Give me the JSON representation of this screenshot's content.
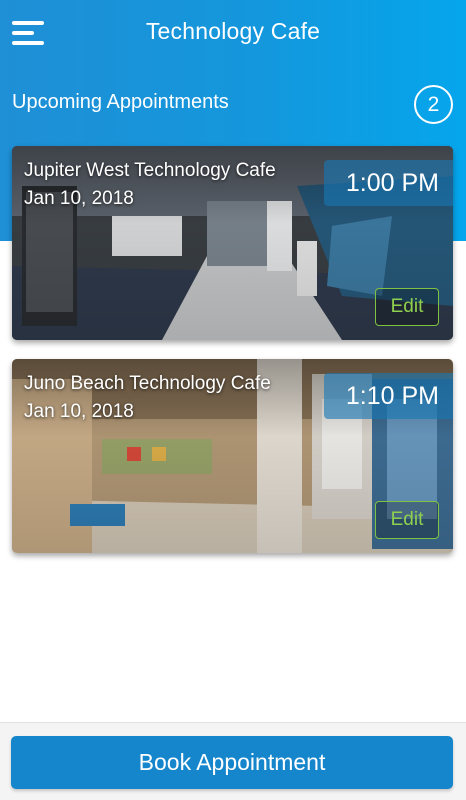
{
  "header": {
    "title": "Technology Cafe",
    "menu_icon": "hamburger-menu-icon"
  },
  "section": {
    "title": "Upcoming Appointments",
    "count": "2"
  },
  "appointments": [
    {
      "location": "Jupiter West Technology Cafe",
      "date": "Jan 10, 2018",
      "time": "1:00 PM",
      "edit_label": "Edit"
    },
    {
      "location": "Juno Beach Technology Cafe",
      "date": "Jan 10, 2018",
      "time": "1:10 PM",
      "edit_label": "Edit"
    }
  ],
  "footer": {
    "book_label": "Book Appointment"
  },
  "colors": {
    "header_blue": "#1497dc",
    "button_blue": "#1686cc",
    "edit_green": "#8fd14f"
  }
}
